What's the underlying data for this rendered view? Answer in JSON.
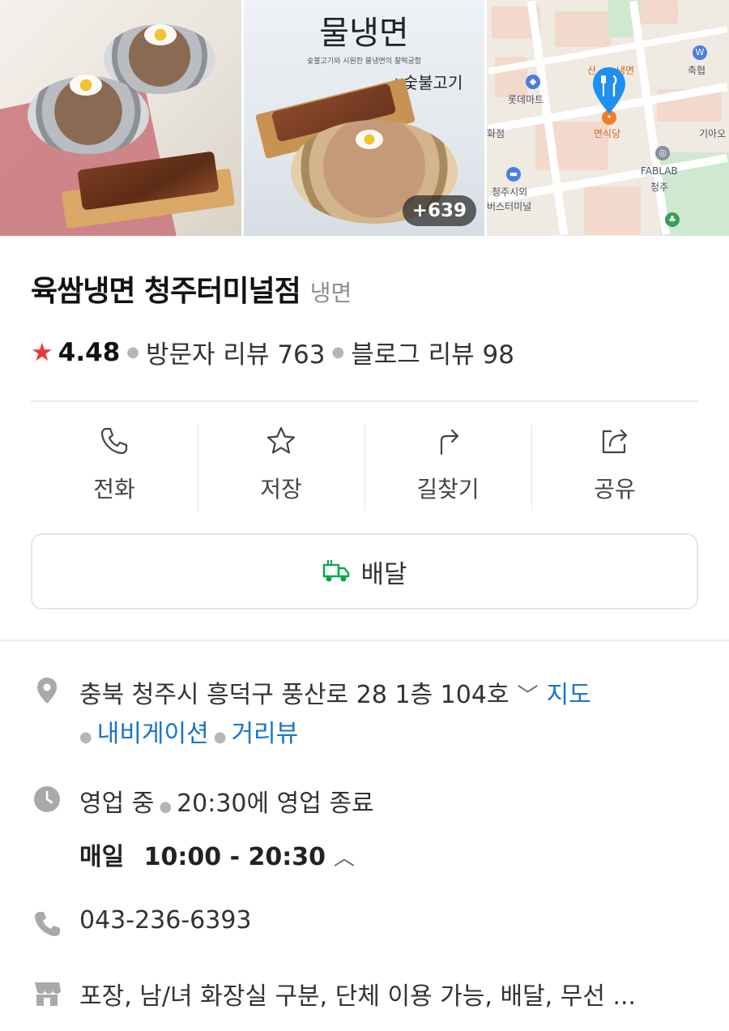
{
  "photos": {
    "photo2_title": "물냉면",
    "photo2_subtitle": "숯불고기와 시원한 물냉면의 찰떡궁합",
    "photo2_addon": "+숯불고기",
    "more_count": "+639"
  },
  "map": {
    "labels": [
      "축협",
      "롯데마트",
      "화점",
      "면식당",
      "기아오",
      "FABLAB",
      "청주",
      "청주시외",
      "버스터미널",
      "산",
      "냉면"
    ]
  },
  "place": {
    "name": "육쌈냉면 청주터미널점",
    "category": "냉면",
    "rating": "4.48",
    "visitor_reviews": "방문자 리뷰 763",
    "blog_reviews": "블로그 리뷰 98"
  },
  "actions": [
    {
      "label": "전화",
      "icon": "phone-icon"
    },
    {
      "label": "저장",
      "icon": "star-icon"
    },
    {
      "label": "길찾기",
      "icon": "directions-icon"
    },
    {
      "label": "공유",
      "icon": "share-icon"
    }
  ],
  "delivery": {
    "label": "배달",
    "icon": "delivery-truck-icon",
    "color": "#03a94d"
  },
  "address": {
    "text": "충북 청주시 흥덕구 풍산로 28 1층 104호",
    "map_link": "지도",
    "nav_link": "내비게이션",
    "street_link": "거리뷰"
  },
  "hours": {
    "status": "영업 중",
    "closing": "20:30에 영업 종료",
    "day_label": "매일",
    "time_range": "10:00 - 20:30"
  },
  "phone": {
    "number": "043-236-6393"
  },
  "amenities": {
    "text": "포장, 남/녀 화장실 구분, 단체 이용 가능, 배달, 무선 ..."
  },
  "colors": {
    "accent_link": "#1a73c8",
    "star": "#e8393a",
    "map_pin": "#1f8ff0"
  }
}
